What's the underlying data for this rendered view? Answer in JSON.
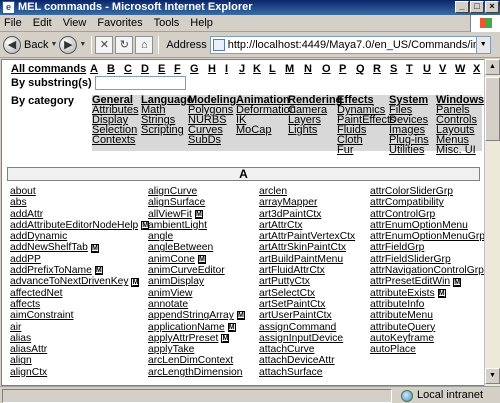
{
  "window": {
    "title": "MEL commands - Microsoft Internet Explorer",
    "minimize": "_",
    "maximize": "□",
    "close": "×",
    "app_icon": "e"
  },
  "menubar": {
    "items": [
      "File",
      "Edit",
      "View",
      "Favorites",
      "Tools",
      "Help"
    ]
  },
  "toolbar": {
    "back_label": "Back",
    "back_icon": "back-arrow-icon",
    "forward_icon": "forward-arrow-icon",
    "address_label": "Address",
    "address_value": "http://localhost:4449/Maya7.0/en_US/Commands/index.html"
  },
  "nav": {
    "all_label": "All commands",
    "letters": [
      "A",
      "B",
      "C",
      "D",
      "E",
      "F",
      "G",
      "H",
      "I",
      "J",
      "K",
      "L",
      "M",
      "N",
      "O",
      "P",
      "Q",
      "R",
      "S",
      "T",
      "U",
      "V",
      "W",
      "X"
    ],
    "substring_label": "By substring(s)",
    "substring_value": "",
    "category_label": "By category"
  },
  "categories": [
    {
      "name": "General",
      "items": [
        "Attributes",
        "Display",
        "Selection",
        "Contexts"
      ]
    },
    {
      "name": "Language",
      "items": [
        "Math",
        "Strings",
        "Scripting"
      ]
    },
    {
      "name": "Modeling",
      "items": [
        "Polygons",
        "NURBS",
        "Curves",
        "SubDs"
      ]
    },
    {
      "name": "Animation",
      "items": [
        "Deformation",
        "IK",
        "MoCap"
      ]
    },
    {
      "name": "Rendering",
      "items": [
        "Camera",
        "Layers",
        "Lights"
      ]
    },
    {
      "name": "Effects",
      "items": [
        "Dynamics",
        "PaintEffects",
        "Fluids",
        "Cloth",
        "Fur"
      ]
    },
    {
      "name": "System",
      "items": [
        "Files",
        "Devices",
        "Images",
        "Plug-ins",
        "Utilities"
      ]
    },
    {
      "name": "Windows",
      "items": [
        "Panels",
        "Controls",
        "Layouts",
        "Menus",
        "Misc. UI"
      ]
    }
  ],
  "section_letter": "A",
  "badge_label": "M",
  "command_columns": [
    [
      {
        "name": "about",
        "m": false
      },
      {
        "name": "abs",
        "m": false
      },
      {
        "name": "addAttr",
        "m": false
      },
      {
        "name": "addAttributeEditorNodeHelp",
        "m": true
      },
      {
        "name": "addDynamic",
        "m": false
      },
      {
        "name": "addNewShelfTab",
        "m": true
      },
      {
        "name": "addPP",
        "m": false
      },
      {
        "name": "addPrefixToName",
        "m": true
      },
      {
        "name": "advanceToNextDrivenKey",
        "m": true
      },
      {
        "name": "affectedNet",
        "m": false
      },
      {
        "name": "affects",
        "m": false
      },
      {
        "name": "aimConstraint",
        "m": false
      },
      {
        "name": "air",
        "m": false
      },
      {
        "name": "alias",
        "m": false
      },
      {
        "name": "aliasAttr",
        "m": false
      },
      {
        "name": "align",
        "m": false
      },
      {
        "name": "alignCtx",
        "m": false
      }
    ],
    [
      {
        "name": "alignCurve",
        "m": false
      },
      {
        "name": "alignSurface",
        "m": false
      },
      {
        "name": "allViewFit",
        "m": true
      },
      {
        "name": "ambientLight",
        "m": false
      },
      {
        "name": "angle",
        "m": false
      },
      {
        "name": "angleBetween",
        "m": false
      },
      {
        "name": "animCone",
        "m": true
      },
      {
        "name": "animCurveEditor",
        "m": false
      },
      {
        "name": "animDisplay",
        "m": false
      },
      {
        "name": "animView",
        "m": false
      },
      {
        "name": "annotate",
        "m": false
      },
      {
        "name": "appendStringArray",
        "m": true
      },
      {
        "name": "applicationName",
        "m": true
      },
      {
        "name": "applyAttrPreset",
        "m": true
      },
      {
        "name": "applyTake",
        "m": false
      },
      {
        "name": "arcLenDimContext",
        "m": false
      },
      {
        "name": "arcLengthDimension",
        "m": false
      }
    ],
    [
      {
        "name": "arclen",
        "m": false
      },
      {
        "name": "arrayMapper",
        "m": false
      },
      {
        "name": "art3dPaintCtx",
        "m": false
      },
      {
        "name": "artAttrCtx",
        "m": false
      },
      {
        "name": "artAttrPaintVertexCtx",
        "m": false
      },
      {
        "name": "artAttrSkinPaintCtx",
        "m": false
      },
      {
        "name": "artBuildPaintMenu",
        "m": false
      },
      {
        "name": "artFluidAttrCtx",
        "m": false
      },
      {
        "name": "artPuttyCtx",
        "m": false
      },
      {
        "name": "artSelectCtx",
        "m": false
      },
      {
        "name": "artSetPaintCtx",
        "m": false
      },
      {
        "name": "artUserPaintCtx",
        "m": false
      },
      {
        "name": "assignCommand",
        "m": false
      },
      {
        "name": "assignInputDevice",
        "m": false
      },
      {
        "name": "attachCurve",
        "m": false
      },
      {
        "name": "attachDeviceAttr",
        "m": false
      },
      {
        "name": "attachSurface",
        "m": false
      }
    ],
    [
      {
        "name": "attrColorSliderGrp",
        "m": false
      },
      {
        "name": "attrCompatibility",
        "m": false
      },
      {
        "name": "attrControlGrp",
        "m": false
      },
      {
        "name": "attrEnumOptionMenu",
        "m": false
      },
      {
        "name": "attrEnumOptionMenuGrp",
        "m": false
      },
      {
        "name": "attrFieldGrp",
        "m": false
      },
      {
        "name": "attrFieldSliderGrp",
        "m": false
      },
      {
        "name": "attrNavigationControlGrp",
        "m": false
      },
      {
        "name": "attrPresetEditWin",
        "m": true
      },
      {
        "name": "attributeExists",
        "m": true
      },
      {
        "name": "attributeInfo",
        "m": false
      },
      {
        "name": "attributeMenu",
        "m": false
      },
      {
        "name": "attributeQuery",
        "m": false
      },
      {
        "name": "autoKeyframe",
        "m": false
      },
      {
        "name": "autoPlace",
        "m": false
      }
    ]
  ],
  "statusbar": {
    "zone_label": "Local intranet"
  }
}
